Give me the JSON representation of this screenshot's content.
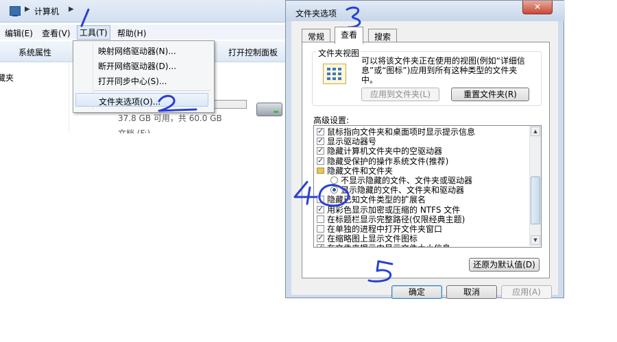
{
  "explorer": {
    "breadcrumb": "计算机",
    "menu": [
      "编辑(E)",
      "查看(V)",
      "工具(T)",
      "帮助(H)"
    ],
    "toolbar": [
      "系统属性",
      "打开控制面板"
    ],
    "nav_item_partial": "藏夹",
    "drive_space": "37.8 GB 可用，共 60.0 GB",
    "drive_usage_fraction": 0.37,
    "partial_label": "文档 (F:)"
  },
  "tools_menu": {
    "items": [
      "映射网络驱动器(N)...",
      "断开网络驱动器(D)...",
      "打开同步中心(S)..."
    ],
    "highlighted_item": "文件夹选项(O)..."
  },
  "dialog": {
    "title": "文件夹选项",
    "close_glyph": "✕",
    "tabs": [
      "常规",
      "查看",
      "搜索"
    ],
    "active_tab": "查看",
    "folder_views": {
      "label": "文件夹视图",
      "description": "可以将该文件夹正在使用的视图(例如“详细信息”或“图标”)应用到所有这种类型的文件夹中。",
      "apply_button": "应用到文件夹(L)",
      "reset_button": "重置文件夹(R)"
    },
    "advanced_label": "高级设置:",
    "advanced_items": [
      {
        "kind": "check",
        "checked": true,
        "text": "鼠标指向文件夹和桌面项时显示提示信息"
      },
      {
        "kind": "check",
        "checked": true,
        "text": "显示驱动器号"
      },
      {
        "kind": "check",
        "checked": true,
        "text": "隐藏计算机文件夹中的空驱动器"
      },
      {
        "kind": "check",
        "checked": true,
        "text": "隐藏受保护的操作系统文件(推荐)"
      },
      {
        "kind": "folder",
        "text": "隐藏文件和文件夹"
      },
      {
        "kind": "radio",
        "checked": false,
        "text": "不显示隐藏的文件、文件夹或驱动器"
      },
      {
        "kind": "radio",
        "checked": true,
        "text": "显示隐藏的文件、文件夹和驱动器"
      },
      {
        "kind": "check",
        "checked": false,
        "text": "隐藏已知文件类型的扩展名"
      },
      {
        "kind": "check",
        "checked": true,
        "text": "用彩色显示加密或压缩的 NTFS 文件"
      },
      {
        "kind": "check",
        "checked": false,
        "text": "在标题栏显示完整路径(仅限经典主题)"
      },
      {
        "kind": "check",
        "checked": false,
        "text": "在单独的进程中打开文件夹窗口"
      },
      {
        "kind": "check",
        "checked": true,
        "text": "在缩略图上显示文件图标"
      },
      {
        "kind": "check",
        "checked": true,
        "text": "在文件夹提示中显示文件大小信息"
      }
    ],
    "restore_defaults_button": "还原为默认值(D)",
    "ok_button": "确定",
    "cancel_button": "取消",
    "apply_button": "应用(A)"
  },
  "annotation_color": "#2b3fd3"
}
